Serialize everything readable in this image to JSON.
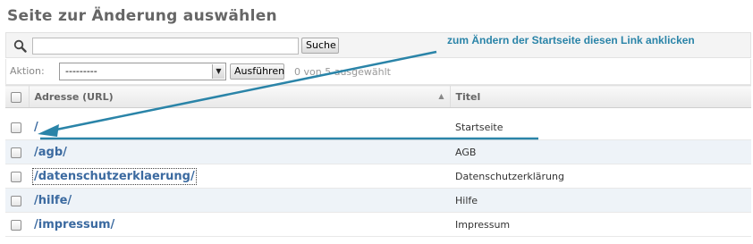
{
  "page": {
    "title": "Seite zur Änderung auswählen"
  },
  "search": {
    "placeholder": "",
    "value": "",
    "button_label": "Suche"
  },
  "actions": {
    "label": "Aktion:",
    "selected_option": "---------",
    "run_button_label": "Ausführen",
    "selection_count": "0 von 5 ausgewählt"
  },
  "table": {
    "columns": {
      "url": "Adresse (URL)",
      "title": "Titel"
    },
    "rows": [
      {
        "url": "/",
        "title": "Startseite"
      },
      {
        "url": "/agb/",
        "title": "AGB"
      },
      {
        "url": "/datenschutzerklaerung/",
        "title": "Datenschutzerklärung"
      },
      {
        "url": "/hilfe/",
        "title": "Hilfe"
      },
      {
        "url": "/impressum/",
        "title": "Impressum"
      }
    ]
  },
  "annotation": {
    "text": "zum Ändern der Startseite diesen Link anklicken",
    "color": "#2a84a8"
  },
  "colors": {
    "link": "#3b6aa0",
    "row_alt": "#eef3f8"
  }
}
